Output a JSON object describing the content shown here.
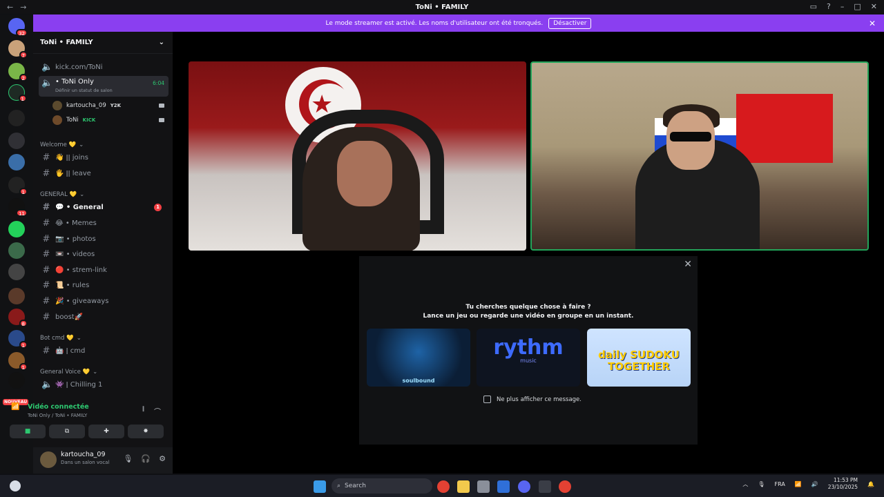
{
  "window": {
    "title": "ToNi • FAMILY"
  },
  "banner": {
    "text": "Le mode streamer est activé. Les noms d'utilisateur ont été tronqués.",
    "button": "Désactiver"
  },
  "servers": {
    "nouveau": "NOUVEAU",
    "badges": [
      "32",
      "7",
      "2",
      "1",
      "1",
      "1",
      "1",
      "1",
      "11",
      "1",
      "1",
      "8",
      "1",
      "1",
      "2"
    ]
  },
  "sidebar": {
    "server_name": "ToNi • FAMILY",
    "link_channel": "kick.com/ToNi",
    "voice_channel": {
      "name": "• ToNi Only",
      "status": "Définir un statut de salon",
      "time": "6:04",
      "users": [
        {
          "name": "kartoucha_09",
          "tag": "Y2K"
        },
        {
          "name": "ToNi",
          "tag": "KICK"
        }
      ]
    },
    "categories": {
      "welcome": "Welcome 💛",
      "general": "GENERAL 💛",
      "botcmd": "Bot cmd 💛",
      "generalvoice": "General Voice 💛"
    },
    "channels": {
      "joins": "👋 ǀǀ joins",
      "leave": "🖐 ǀǀ leave",
      "general": "💬 • General",
      "general_unread": "1",
      "memes": "😂 • Memes",
      "photos": "📷 • photos",
      "videos": "📼 • videos",
      "streamlink": "🔴 • strem-link",
      "rules": "📜 • rules",
      "giveaways": "🎉 • giveaways",
      "boost": "boost🚀",
      "cmd": "🤖 ǀ cmd",
      "chilling": "👾 ǀ Chilling 1"
    }
  },
  "voice_panel": {
    "status": "Vidéo connectée",
    "location": "ToNi Only / ToNi • FAMILY"
  },
  "user": {
    "name": "kartoucha_09",
    "status": "Dans un salon vocal"
  },
  "activity": {
    "question": "Tu cherches quelque chose à faire ?",
    "sub": "Lance un jeu ou regarde une vidéo en groupe en un instant.",
    "cards": [
      "soulbound",
      "rythm",
      "music",
      "daily SUDOKU TOGETHER"
    ],
    "checkbox": "Ne plus afficher ce message."
  },
  "taskbar": {
    "search": "Search",
    "lang": "FRA",
    "time": "11:53 PM",
    "date": "23/10/2025"
  }
}
